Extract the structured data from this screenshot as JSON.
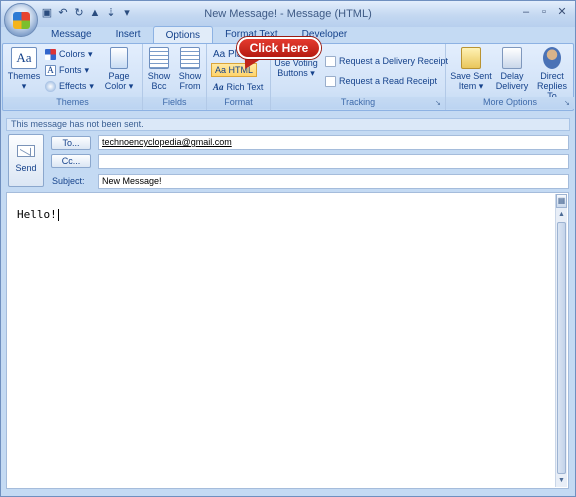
{
  "window": {
    "title": "New Message! - Message (HTML)"
  },
  "qat": {
    "save_icon": "save-icon",
    "undo_icon": "undo-icon",
    "redo_icon": "redo-icon",
    "up_icon": "arrow-up-icon",
    "down_icon": "arrow-down-icon"
  },
  "tabs": [
    {
      "label": "Message"
    },
    {
      "label": "Insert"
    },
    {
      "label": "Options"
    },
    {
      "label": "Format Text"
    },
    {
      "label": "Developer"
    }
  ],
  "ribbon": {
    "themes_group": {
      "label": "Themes",
      "themes_button": "Themes",
      "colors": "Colors",
      "fonts": "Fonts",
      "effects": "Effects",
      "page_color": [
        "Page",
        "Color"
      ]
    },
    "fields_group": {
      "label": "Fields",
      "show_bcc": [
        "Show",
        "Bcc"
      ],
      "show_from": [
        "Show",
        "From"
      ]
    },
    "format_group": {
      "label": "Format",
      "plain": "Aa Pla",
      "html": "Aa HTML",
      "rich_text": "Rich Text",
      "rich_prefix": "Aa"
    },
    "tracking_group": {
      "label": "Tracking",
      "use_voting": [
        "Use Voting",
        "Buttons"
      ],
      "delivery_receipt": "Request a Delivery Receipt",
      "read_receipt": "Request a Read Receipt"
    },
    "more_group": {
      "label": "More Options",
      "save_sent": [
        "Save Sent",
        "Item"
      ],
      "delay": [
        "Delay",
        "Delivery"
      ],
      "direct": [
        "Direct",
        "Replies To"
      ]
    }
  },
  "callout": {
    "text": "Click Here"
  },
  "infobar": {
    "text": "This message has not been sent."
  },
  "compose": {
    "send_label": "Send",
    "to_label": "To...",
    "cc_label": "Cc...",
    "subject_label": "Subject:",
    "to_value": "technoencyclopedia@gmail.com",
    "cc_value": "",
    "subject_value": "New Message!"
  },
  "body": {
    "text": "Hello!"
  }
}
